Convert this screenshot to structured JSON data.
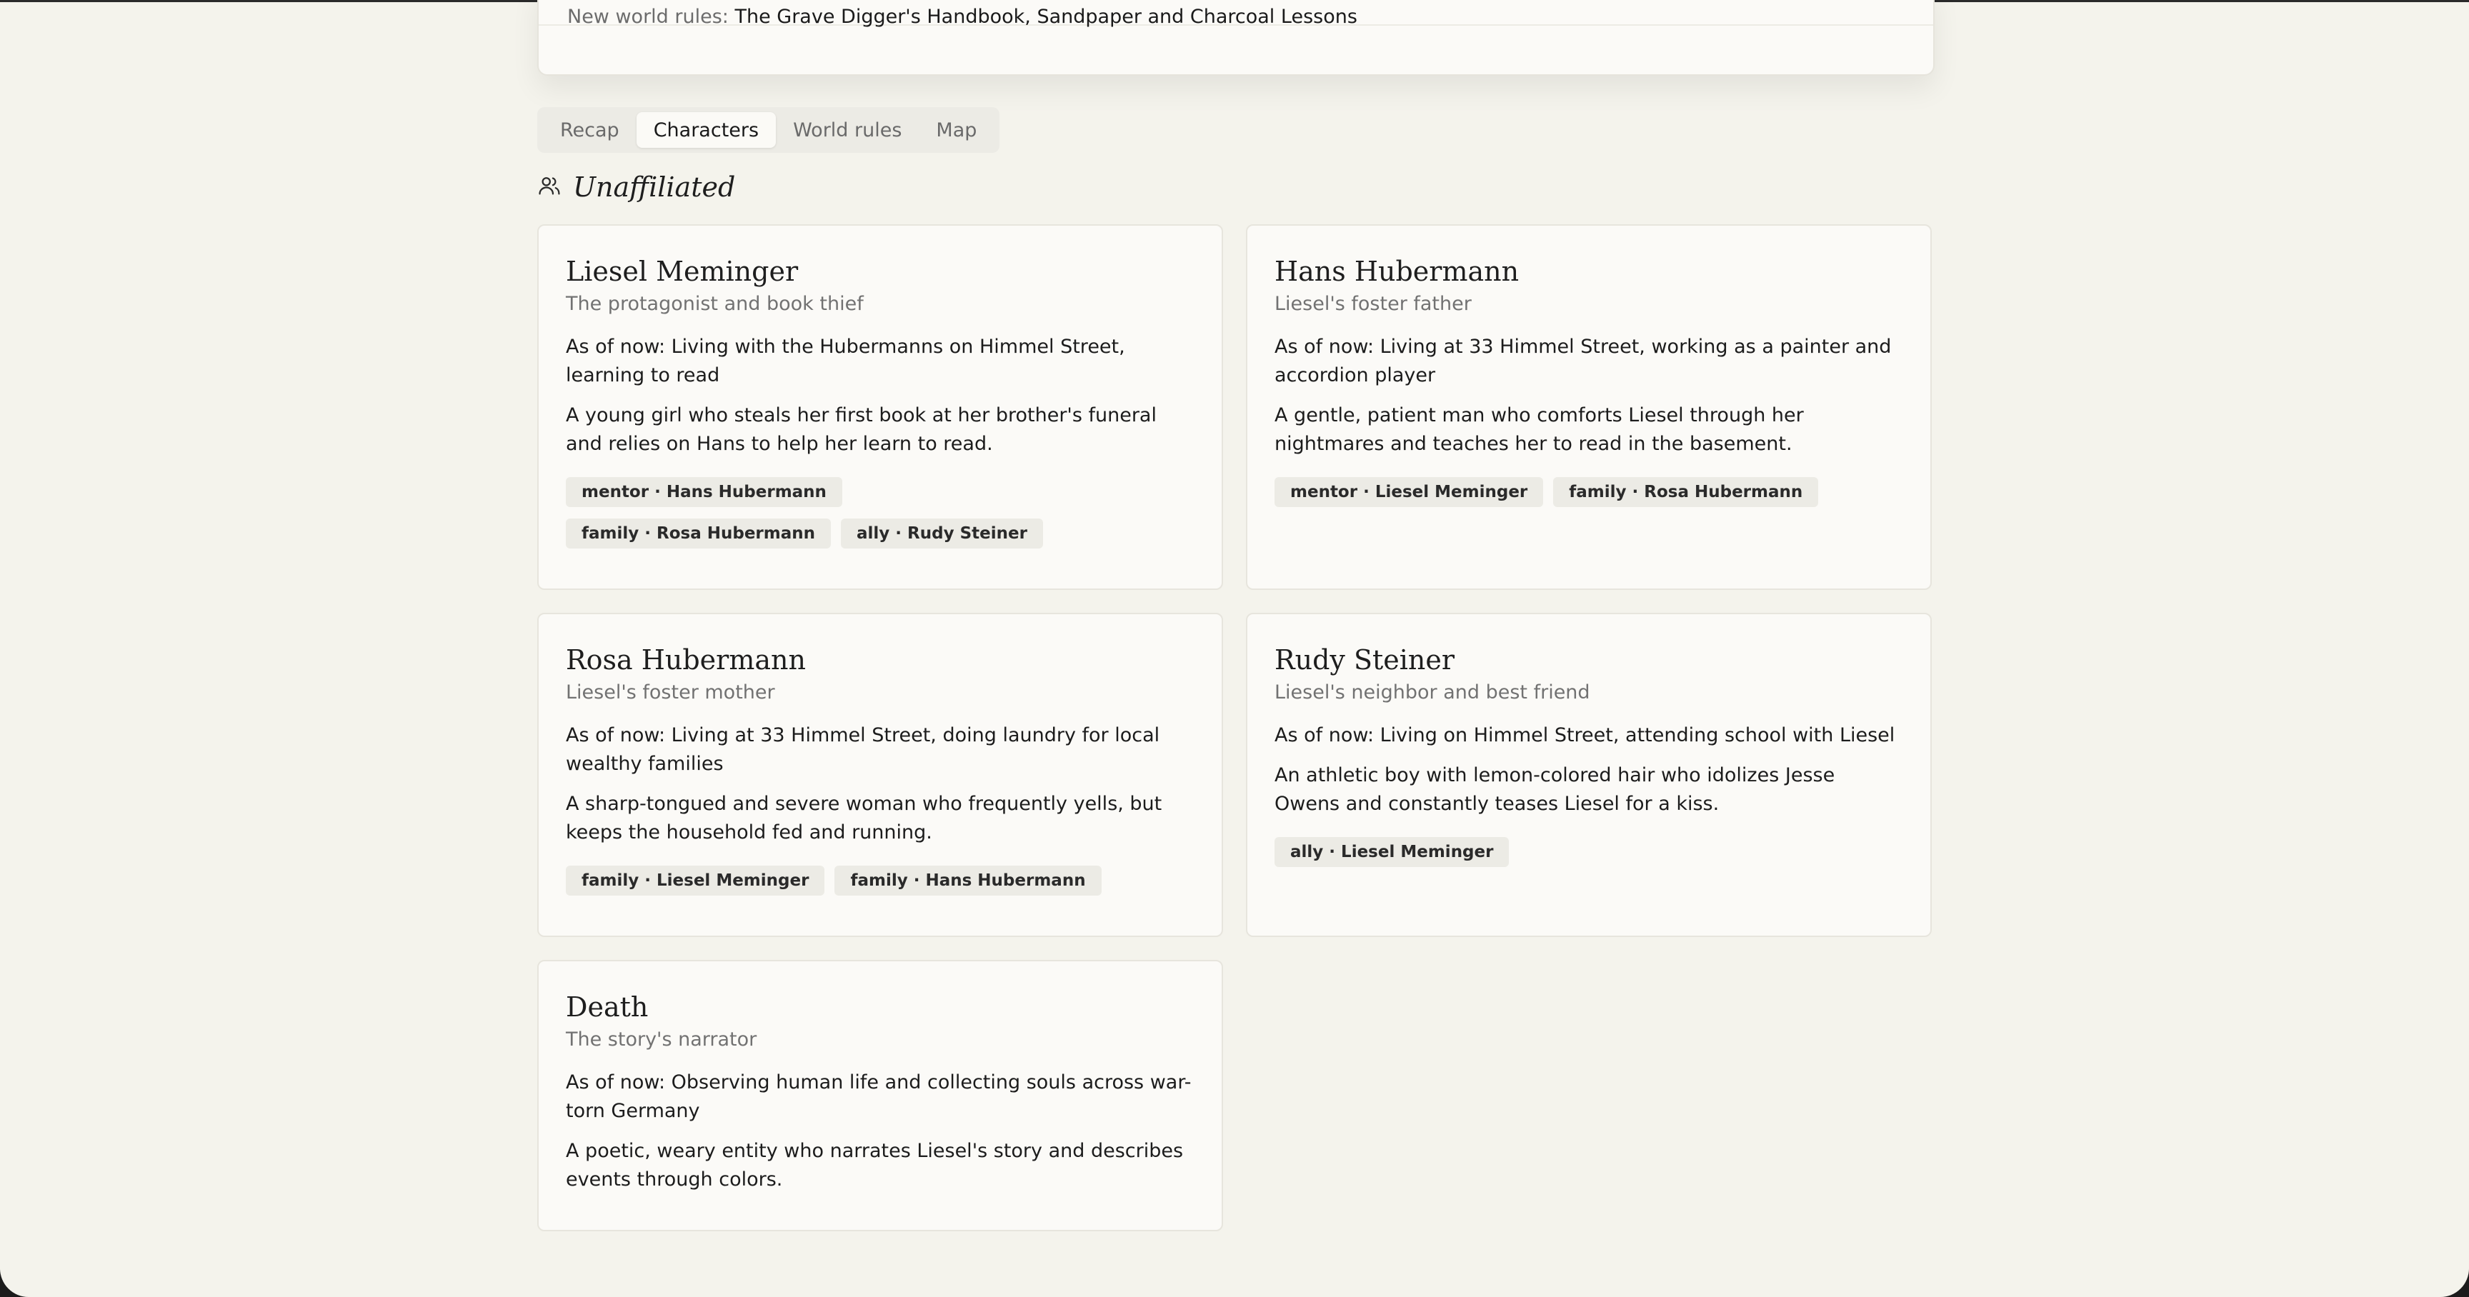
{
  "summary": {
    "partial_text": "…",
    "rules_label": "New world rules:",
    "rules_value": "The Grave Digger's Handbook, Sandpaper and Charcoal Lessons"
  },
  "tabs": [
    {
      "label": "Recap",
      "active": false
    },
    {
      "label": "Characters",
      "active": true
    },
    {
      "label": "World rules",
      "active": false
    },
    {
      "label": "Map",
      "active": false
    }
  ],
  "group": {
    "icon": "users-icon",
    "title": "Unaffiliated"
  },
  "characters": [
    {
      "name": "Liesel Meminger",
      "role": "The protagonist and book thief",
      "status": "As of now: Living with the Hubermanns on Himmel Street, learning to read",
      "description": "A young girl who steals her first book at her brother's funeral and relies on Hans to help her learn to read.",
      "relations": [
        "mentor · Hans Hubermann",
        "family · Rosa Hubermann",
        "ally · Rudy Steiner"
      ]
    },
    {
      "name": "Hans Hubermann",
      "role": "Liesel's foster father",
      "status": "As of now: Living at 33 Himmel Street, working as a painter and accordion player",
      "description": "A gentle, patient man who comforts Liesel through her nightmares and teaches her to read in the basement.",
      "relations": [
        "mentor · Liesel Meminger",
        "family · Rosa Hubermann"
      ]
    },
    {
      "name": "Rosa Hubermann",
      "role": "Liesel's foster mother",
      "status": "As of now: Living at 33 Himmel Street, doing laundry for local wealthy families",
      "description": "A sharp-tongued and severe woman who frequently yells, but keeps the household fed and running.",
      "relations": [
        "family · Liesel Meminger",
        "family · Hans Hubermann"
      ]
    },
    {
      "name": "Rudy Steiner",
      "role": "Liesel's neighbor and best friend",
      "status": "As of now: Living on Himmel Street, attending school with Liesel",
      "description": "An athletic boy with lemon-colored hair who idolizes Jesse Owens and constantly teases Liesel for a kiss.",
      "relations": [
        "ally · Liesel Meminger"
      ]
    },
    {
      "name": "Death",
      "role": "The story's narrator",
      "status": "As of now: Observing human life and collecting souls across war-torn Germany",
      "description": "A poetic, weary entity who narrates Liesel's story and describes events through colors.",
      "relations": []
    }
  ]
}
